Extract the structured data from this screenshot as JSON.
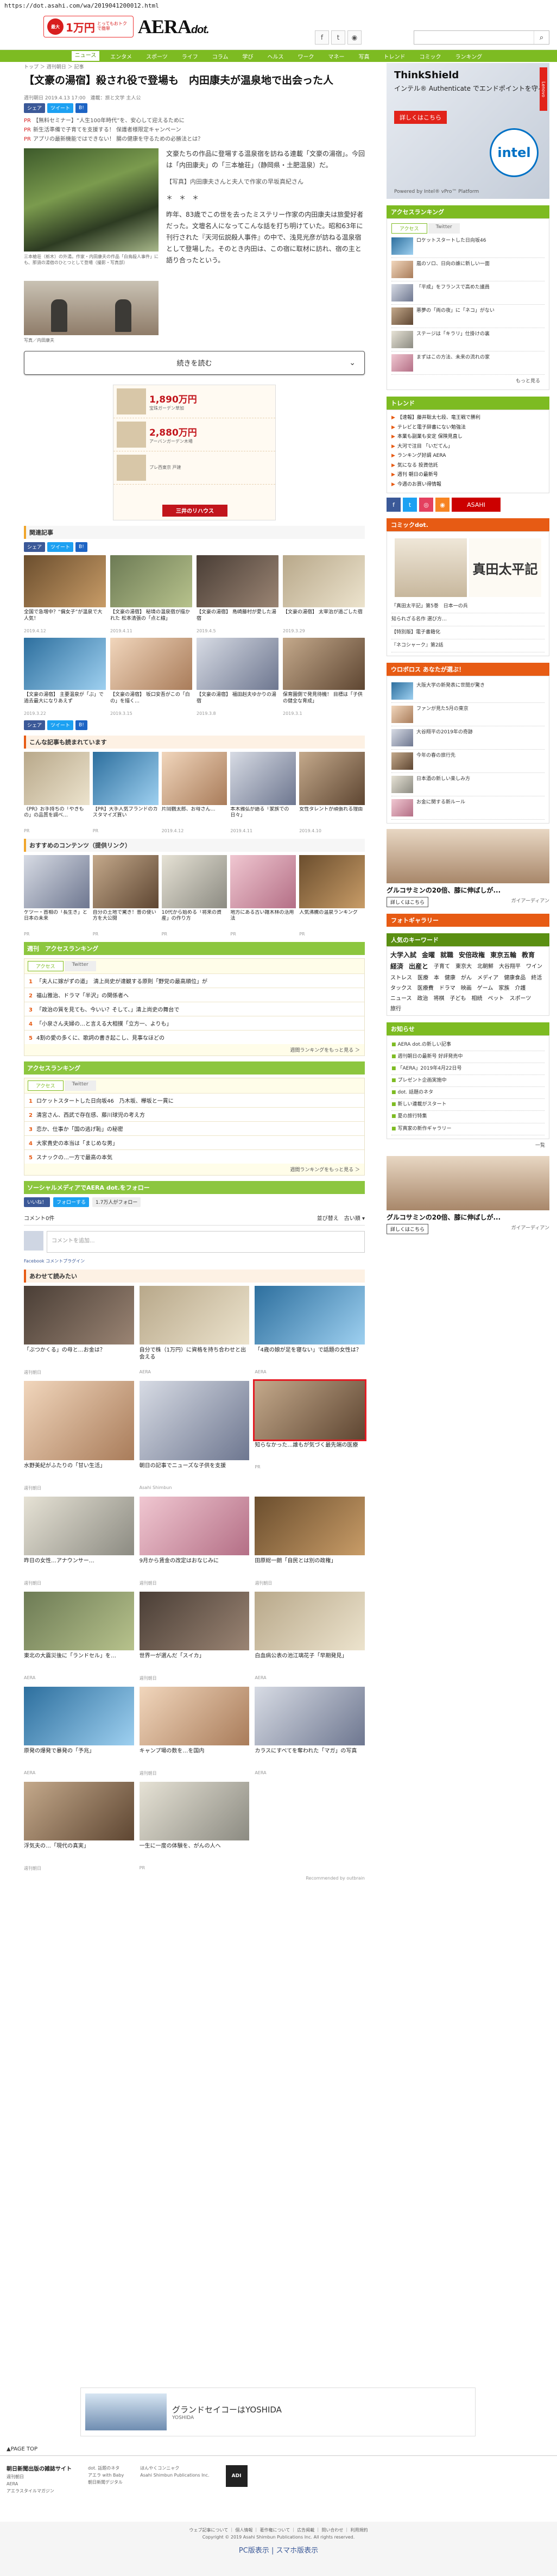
{
  "url": "https://dot.asahi.com/wa/2019041200012.html",
  "header": {
    "promo_circle": "最大",
    "promo_amount": "1万円",
    "promo_text": "とってもおトクで簡単",
    "logo": "AERA",
    "logo_suffix": "dot.",
    "search_placeholder": ""
  },
  "nav": [
    "ニュース",
    "エンタメ",
    "スポーツ",
    "ライフ",
    "コラム",
    "学び",
    "ヘルス",
    "ワーク",
    "マネー",
    "写真",
    "トレンド",
    "コミック",
    "ランキング"
  ],
  "nav_active": "ニュース",
  "breadcrumb": "トップ ＞ 週刊朝日 ＞ 記事",
  "title": "【文豪の湯宿】殺され役で登場も　内田康夫が温泉地で出会った人",
  "date": "週刊朝日 2019.4.13 17:00　連載：旅と文学 主人公",
  "share": {
    "fb": "シェア",
    "tw": "ツイート",
    "bk": "B!"
  },
  "pr": [
    {
      "tag": "PR",
      "text": "【無料セミナー】“人生100年時代”を、安心して迎えるために"
    },
    {
      "tag": "PR",
      "text": "新生活準備で子育てを支援する！ 保護者様限定キャンペーン"
    },
    {
      "tag": "PR",
      "text": "アプリの最新機能ではできない！ 腸の健康を守るための必勝法とは？"
    }
  ],
  "caption1": "三本槍荘（栃木）の外湯。作家・内田康夫の作品「白鳥殺人事件」にも、那須の湯宿のひとつとして登場（撮影・写真部）",
  "caption2": "写真／内田康夫",
  "article_paras": [
    "文豪たちの作品に登場する温泉宿を訪ねる連載「文豪の湯宿」。今回は「内田康夫」の「三本槍荘」（静岡県・土肥温泉）だ。",
    "【写真】内田康夫さんと夫人で作家の早坂真紀さん",
    "＊　＊　＊",
    "昨年、83歳でこの世を去ったミステリー作家の内田康夫は旅愛好者だった。文壇名人になってこんな話を打ち明けていた。昭和63年に刊行された『天河伝説殺人事件』の中で、浅見光彦が訪ねる温泉宿として登場した。そのとき内田は、この宿に取材に訪れ、宿の主と語り合ったという。"
  ],
  "readmore": "続きを読む",
  "ad_main": [
    {
      "price": "1,890",
      "unit": "万円",
      "sub": "宝珠ガーデン草加"
    },
    {
      "price": "2,880",
      "unit": "万円",
      "sub": "アーバンガーデン木場"
    },
    {
      "price": "",
      "unit": "",
      "sub": "プレ西東京 戸建"
    }
  ],
  "ad_logo": "三井のリハウス",
  "related_head": "関連記事",
  "related": [
    {
      "t": "全国で急増中？“偏女子”が温泉で大人気！",
      "m": "2019.4.12"
    },
    {
      "t": "【文豪の湯宿】 秘境の温泉宿が描かれた 松本清張の「点と線」",
      "m": "2019.4.11"
    },
    {
      "t": "【文豪の湯宿】 島崎藤村が愛した湯宿",
      "m": "2019.4.5"
    },
    {
      "t": "【文豪の湯宿】 太宰治が過ごした宿",
      "m": "2019.3.29"
    },
    {
      "t": "【文豪の湯宿】 主要温泉が「ぶ」で過去最大になりあえず",
      "m": "2019.3.22"
    },
    {
      "t": "【文豪の湯宿】 坂口安吾がこの「白の」を描く…",
      "m": "2019.3.15"
    },
    {
      "t": "【文豪の湯宿】 福田赳夫ゆかりの湯宿",
      "m": "2019.3.8"
    },
    {
      "t": "保育園側で発見待機！ 目標は「子供の健全な育成」",
      "m": "2019.3.1"
    }
  ],
  "also_head": "こんな記事も読まれています",
  "also": [
    {
      "t": "《PR》お手持ちの「やきもの」の品質を調べ…",
      "m": "PR"
    },
    {
      "t": "【PR】大手人気ブランドのカスタマイズ買い",
      "m": "PR"
    },
    {
      "t": "片岡鶴太郎、お母さん…",
      "m": "2019.4.12"
    },
    {
      "t": "本木雅弘が語る「家族での日々」",
      "m": "2019.4.11"
    },
    {
      "t": "女性タレントが頑張れる理由",
      "m": "2019.4.10"
    }
  ],
  "osusume_head": "おすすめのコンテンツ（提供リンク）",
  "osusume": [
    {
      "t": "ケツ一・首相の「長生き」と日本の未来",
      "m": "PR"
    },
    {
      "t": "自分の土地で驚き！昔の使い方を大公開",
      "m": "PR"
    },
    {
      "t": "10代から始める「将来の資産」の作り方",
      "m": "PR"
    },
    {
      "t": "地方にある古い雑木林の活用法",
      "m": "PR"
    },
    {
      "t": "人気沸騰の温泉ランキング",
      "m": "PR"
    }
  ],
  "weekly_rank_head": "週刊　アクセスランキング",
  "weekly_tabs": [
    "アクセス",
    "Twitter"
  ],
  "weekly_rank": [
    "「夫人に嫁がずの道」　清上尚史が達観する原則「野党の最高順位」が",
    "福山雅治、ドラマ「半沢」の関係者へ",
    "「政治の質を見ても、今いい？そして、」清上尚史の舞台で",
    "「小泉さん夫婦の…と言える大相撲「立方一、よりも」",
    "4割の愛の多くに、歌詞の書き起こし、見事なほどの"
  ],
  "all_rank_head": "アクセスランキング",
  "all_tabs": [
    "アクセス",
    "Twitter"
  ],
  "all_rank": [
    "ロケットスタートした日向坂46　乃木坂、欅坂と一貫に",
    "清宮さん、西武で存在感、藤川球児の考え方",
    "恋か、仕事か「国の逃げ恥」の秘密",
    "大家貴史の本当は「まじめな男」",
    "スナックの…一方で最高の本気"
  ],
  "more": "週間ランキングをもっと見る ＞",
  "follow_head": "ソーシャルメディアでAERA dot.をフォロー",
  "follow": {
    "like": "いいね！",
    "tw": "フォローする",
    "share": "1.7万人がフォロー"
  },
  "comment": {
    "count": "コメント0件",
    "sort": "並び替え　古い順 ▾",
    "placeholder": "コメントを追加...",
    "plugin": "Facebook コメントプラグイン"
  },
  "rec_head": "あわせて読みたい",
  "recs": [
    {
      "t": "「ぶつかくる」の母と…お金は？",
      "m": "週刊朝日"
    },
    {
      "t": "自分で株（1万円）に資格を持ち合わせと出会える",
      "m": "AERA"
    },
    {
      "t": "「4歳の娘が足を寝ない」で話題の女性は？",
      "m": "AERA"
    },
    {
      "t": "水野美紀がふたりの「甘い生活」",
      "m": "週刊朝日"
    },
    {
      "t": "朝日の記事でニューズな子供を支援",
      "m": "Asahi Shimbun"
    },
    {
      "t": "知らなかった…誰もが気づく最先端の医療",
      "m": "PR"
    },
    {
      "t": "昨日の女性…アナウンサー…",
      "m": "週刊朝日"
    },
    {
      "t": "9月から賃金の改定はおなじみに",
      "m": "週刊朝日"
    },
    {
      "t": "田原総一朗「自民とは別の政権」",
      "m": "週刊朝日"
    },
    {
      "t": "東北の大震災後に「ランドセル」を…",
      "m": "AERA"
    },
    {
      "t": "世界一が選んだ「スイカ」",
      "m": "週刊朝日"
    },
    {
      "t": "白血病公表の池江璃花子「早期発見」",
      "m": "AERA"
    },
    {
      "t": "原発の爆発で暴発の「予兆」",
      "m": "AERA"
    },
    {
      "t": "キャンプ場の数を…を国内",
      "m": "週刊朝日"
    },
    {
      "t": "カラスにすべてを奪われた「マガ」の写真",
      "m": "AERA"
    },
    {
      "t": "浮気夫の…「現代の真実」",
      "m": "週刊朝日"
    },
    {
      "t": "一生に一度の体験を、がんの人へ",
      "m": "PR"
    }
  ],
  "rec_sign": "Recommended by outbrain",
  "bottom_ad": {
    "title": "グランドセイコーはYOSHIDA",
    "sub": "YOSHIDA"
  },
  "footer_top": "▲PAGE TOP",
  "footer_cols": [
    {
      "h": "朝日新聞出版の雑誌サイト",
      "items": [
        "週刊朝日",
        "AERA",
        "アエラスタイルマガジン"
      ]
    },
    {
      "h": "",
      "items": [
        "dot. 話題のネタ",
        "アエラ with Baby",
        "朝日新聞デジタル"
      ]
    },
    {
      "h": "",
      "items": [
        "ほんやくコンニャク",
        "Asahi Shimbun Publications Inc."
      ]
    }
  ],
  "footer_adi": "ADI",
  "footer_links": "ウェブ記事について ｜ 個人情報 ｜ 著作権について ｜ 広告掲載 ｜ 問い合わせ ｜ 利用規約",
  "copyright": "Copyright © 2019 Asahi Shimbun Publications Inc. All rights reserved.",
  "switch": "PC版表示 | スマホ版表示",
  "side": {
    "ad_top": {
      "brand": "ThinkShield",
      "text": "インテル® Authenticate でエンドポイントを守る",
      "btn": "詳しくはこちら",
      "intel": "intel",
      "pw": "Powered by Intel® vPro™ Platform",
      "lenovo": "Lenovo"
    },
    "rank_head": "アクセスランキング",
    "rank_tabs": [
      "アクセス",
      "Twitter"
    ],
    "rank": [
      "ロケットスタートした日向坂46",
      "嵐のソロ、日向の誰に新しい一面",
      "「平成」をフランスで高めた議員",
      "悪夢の「両の夜」に「ネコ」がない",
      "ステージは「キラリ」仕掛けの裏",
      "まずはこの方法、未来の流れの家"
    ],
    "rank_more": "もっと見る",
    "trend_head": "トレンド",
    "trends": [
      "【速報】藤井聡太七段、竜王戦で勝利",
      "テレビと電子辞書にない勉強法",
      "本業も副業も安定 保険見直し",
      "大河で注目 「いだてん」",
      "ランキング好調 AERA",
      "気になる 投資信託",
      "週刊 朝日の最新号",
      "今週のお買い得情報"
    ],
    "social_head": "",
    "comic_head": "コミックdot.",
    "comic_title": "真田太平記",
    "comic_items": [
      "「真田太平記」第5巻　日本一の兵",
      "知られざる名作 選び方…",
      "【特別版】電子書籍化",
      "『ネコシャーク』第2話"
    ],
    "weekly_head": "ウロボロス あなたが選ぶ！",
    "weekly_items": [
      "大阪大学の新発表に世間が驚き",
      "ファンが見た5月の東京",
      "大谷翔平の2019年の奇跡",
      "今年の春の旅行先",
      "日本酒の新しい楽しみ方",
      "お金に関する新ルール"
    ],
    "gluco_title": "グルコサミンの20倍、膝に伸ばしが...",
    "gluco_btn": "詳しくはこちら",
    "gluco_sponsor": "ガイアーディアン",
    "photo_head": "フォトギャラリー",
    "kw_head": "人気のキーワード",
    "keywords": [
      "大学入試",
      "金曜",
      "就職",
      "安倍政権",
      "東京五輪",
      "教育",
      "経済",
      "出産と",
      "子育て",
      "東京大",
      "北朝鮮",
      "大谷翔平",
      "ワイン",
      "ストレス",
      "医療",
      "本",
      "健康",
      "がん",
      "メディア",
      "健康食品",
      "終活",
      "タックス",
      "医療費",
      "ドラマ",
      "映画",
      "ゲーム",
      "家族",
      "介護",
      "ニュース",
      "政治",
      "将棋",
      "子ども",
      "相続",
      "ペット",
      "スポーツ",
      "旅行"
    ],
    "news_head": "お知らせ",
    "news": [
      "AERA dot.の新しい記事",
      "週刊朝日の最新号 好評発売中",
      "「AERA」2019年4月22日号",
      "プレゼント企画実施中",
      "dot. 話題のネタ",
      "新しい連載がスタート",
      "夏の旅行特集",
      "写真家の新作ギャラリー"
    ],
    "news_more": "一覧",
    "gluco2_title": "グルコサミンの20倍、膝に伸ばしが...",
    "gluco2_btn": "詳しくはこちら"
  }
}
